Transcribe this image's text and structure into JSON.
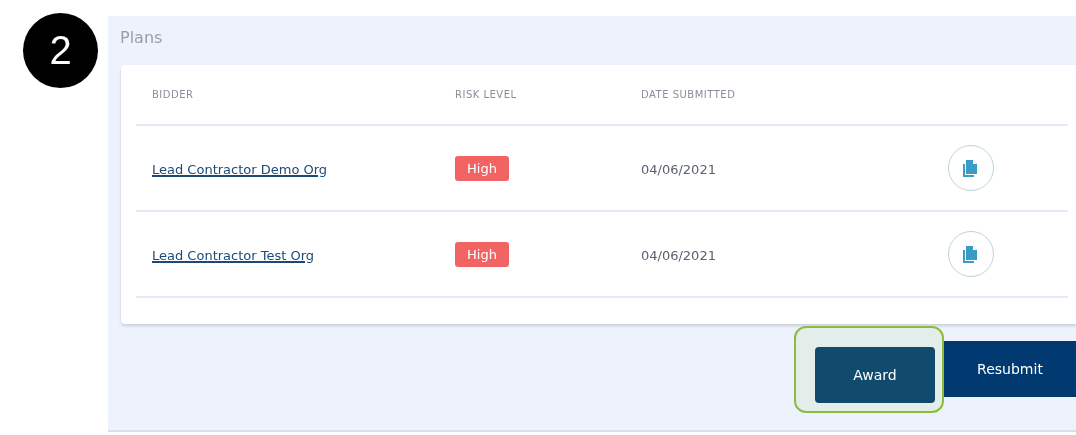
{
  "step": "2",
  "panel": {
    "title": "Plans"
  },
  "table": {
    "columns": [
      "BIDDER",
      "RISK LEVEL",
      "DATE SUBMITTED"
    ],
    "rows": [
      {
        "bidder": "Lead Contractor Demo Org",
        "risk": "High",
        "date": "04/06/2021"
      },
      {
        "bidder": "Lead Contractor Test Org",
        "risk": "High",
        "date": "04/06/2021"
      }
    ]
  },
  "buttons": [
    {
      "label": "Award",
      "kind": "award",
      "highlighted": true
    },
    {
      "label": "Resubmit",
      "kind": "resubmit",
      "highlighted": false
    }
  ]
}
